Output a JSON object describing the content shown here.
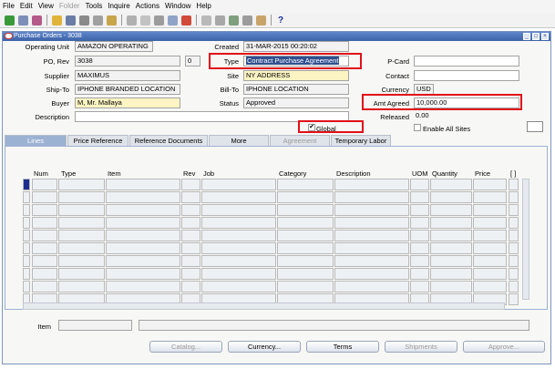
{
  "menu": [
    {
      "label": "File",
      "enabled": true
    },
    {
      "label": "Edit",
      "enabled": true
    },
    {
      "label": "View",
      "enabled": true
    },
    {
      "label": "Folder",
      "enabled": false
    },
    {
      "label": "Tools",
      "enabled": true
    },
    {
      "label": "Inquire",
      "enabled": true
    },
    {
      "label": "Actions",
      "enabled": true
    },
    {
      "label": "Window",
      "enabled": true
    },
    {
      "label": "Help",
      "enabled": true
    }
  ],
  "toolbar": {
    "help": "?"
  },
  "window": {
    "title": "Purchase Orders - 3038"
  },
  "header": {
    "operating_unit": {
      "label": "Operating Unit",
      "value": "AMAZON OPERATING"
    },
    "created": {
      "label": "Created",
      "value": "31-MAR-2015 00:20:02"
    },
    "po_rev": {
      "label": "PO, Rev",
      "value": "3038",
      "rev": "0"
    },
    "type": {
      "label": "Type",
      "value": "Contract Purchase Agreement"
    },
    "pcard": {
      "label": "P-Card",
      "value": ""
    },
    "supplier": {
      "label": "Supplier",
      "value": "MAXIMUS"
    },
    "site": {
      "label": "Site",
      "value": "NY ADDRESS"
    },
    "contact": {
      "label": "Contact",
      "value": ""
    },
    "ship_to": {
      "label": "Ship-To",
      "value": "IPHONE BRANDED LOCATION"
    },
    "bill_to": {
      "label": "Bill-To",
      "value": "IPHONE LOCATION"
    },
    "currency": {
      "label": "Currency",
      "value": "USD"
    },
    "buyer": {
      "label": "Buyer",
      "value": "M, Mr. Mallaya"
    },
    "status": {
      "label": "Status",
      "value": "Approved"
    },
    "amt_agreed": {
      "label": "Amt Agreed",
      "value": "10,000.00"
    },
    "description": {
      "label": "Description",
      "value": ""
    },
    "released": {
      "label": "Released",
      "value": "0.00"
    },
    "global": {
      "label": "Global",
      "checked": true
    },
    "enable_all_sites": {
      "label": "Enable All Sites",
      "checked": false
    }
  },
  "tabs": [
    {
      "label": "Lines",
      "active": true
    },
    {
      "label": "Price Reference",
      "active": false
    },
    {
      "label": "Reference Documents",
      "active": false
    },
    {
      "label": "More",
      "active": false
    },
    {
      "label": "Agreement",
      "active": false,
      "disabled": true
    },
    {
      "label": "Temporary Labor",
      "active": false
    }
  ],
  "lines_table": {
    "columns": [
      "Num",
      "Type",
      "Item",
      "Rev",
      "Job",
      "Category",
      "Description",
      "UOM",
      "Quantity",
      "Price",
      "[ ]"
    ],
    "row_count": 10
  },
  "item_label": "Item",
  "buttons": [
    {
      "label": "Catalog...",
      "enabled": false
    },
    {
      "label": "Currency...",
      "enabled": true
    },
    {
      "label": "Terms",
      "enabled": true
    },
    {
      "label": "Shipments",
      "enabled": false
    },
    {
      "label": "Approve...",
      "enabled": false
    }
  ],
  "colors": {
    "accent": "#3c62a8",
    "highlight_box": "#e0101a",
    "required_field": "#fdf4c3"
  }
}
